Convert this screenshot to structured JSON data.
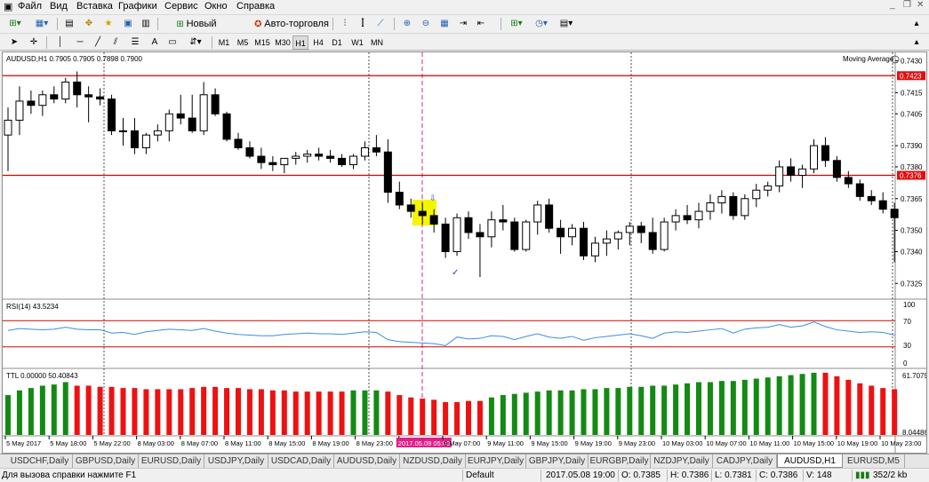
{
  "menu": {
    "items": [
      "Файл",
      "Вид",
      "Вставка",
      "Графики",
      "Сервис",
      "Окно",
      "Справка"
    ]
  },
  "toolbar": {
    "new_order_label": "Новый ордер",
    "autotrading_label": "Авто-торговля",
    "timeframes": [
      "M1",
      "M5",
      "M15",
      "M30",
      "H1",
      "H4",
      "D1",
      "W1",
      "MN"
    ],
    "active_timeframe": "H1",
    "text_tool_label": "A"
  },
  "chart_header": {
    "symbol_line": "AUDUSD,H1  0.7905 0.7905 0.7898 0.7900",
    "indicator_label": "Moving Average"
  },
  "rsi": {
    "label": "RSI(14) 43.5234",
    "levels": [
      "70",
      "30"
    ],
    "bottom_label": "0",
    "top_label": "100"
  },
  "ttl": {
    "label": "TTL 0.00000 50.40843",
    "top_value": "61.70795",
    "bottom_value": "8.04486"
  },
  "price_axis": {
    "ticks": [
      "0.7430",
      "0.7415",
      "0.7405",
      "0.7390",
      "0.7380",
      "0.7365",
      "0.7350",
      "0.7340",
      "0.7325"
    ],
    "highlight_high": "0.7423",
    "highlight_mid": "0.7376"
  },
  "time_axis": {
    "labels": [
      "5 May 2017",
      "5 May 18:00",
      "5 May 22:00",
      "8 May 03:00",
      "8 May 07:00",
      "8 May 11:00",
      "8 May 15:00",
      "8 May 19:00",
      "8 May 23:00",
      "2017.05.09 05:00",
      "9 May 07:00",
      "9 May 11:00",
      "9 May 15:00",
      "9 May 19:00",
      "9 May 23:00",
      "10 May 03:00",
      "10 May 07:00",
      "10 May 11:00",
      "10 May 15:00",
      "10 May 19:00",
      "10 May 23:00"
    ],
    "highlight_label": "2017.05.09 05:00"
  },
  "tabs": [
    "USDCHF,Daily",
    "GBPUSD,Daily",
    "EURUSD,Daily",
    "USDJPY,Daily",
    "USDCAD,Daily",
    "AUDUSD,Daily",
    "NZDUSD,Daily",
    "EURJPY,Daily",
    "GBPJPY,Daily",
    "EURGBP,Daily",
    "NZDJPY,Daily",
    "CADJPY,Daily",
    "AUDUSD,H1",
    "EURUSD,M5"
  ],
  "active_tab": "AUDUSD,H1",
  "status": {
    "help": "Для вызова справки нажмите F1",
    "profile": "Default",
    "datetime": "2017.05.08 19:00",
    "open": "O: 0.7385",
    "high": "H: 0.7386",
    "low": "L: 0.7381",
    "close": "C: 0.7386",
    "volume": "V: 148",
    "traffic": "352/2 kb"
  },
  "colors": {
    "candle_bull": "#ffffff",
    "candle_bear": "#000000",
    "level_line": "#d40000",
    "rsi_line": "#3a8ee6",
    "hist_green": "#138a13",
    "hist_red": "#ee1111",
    "crosshair": "#e0208a",
    "highlight": "#f5f500"
  },
  "chart_data": {
    "type": "candlestick",
    "symbol": "AUDUSD",
    "timeframe": "H1",
    "ylim": [
      0.7318,
      0.7434
    ],
    "horizontal_levels": [
      0.7423,
      0.7376
    ],
    "candles": [
      [
        0.7395,
        0.7408,
        0.7378,
        0.7402
      ],
      [
        0.7402,
        0.7418,
        0.7395,
        0.7411
      ],
      [
        0.7411,
        0.7416,
        0.7405,
        0.7409
      ],
      [
        0.7409,
        0.7416,
        0.7404,
        0.7414
      ],
      [
        0.7414,
        0.7418,
        0.741,
        0.7412
      ],
      [
        0.7412,
        0.7422,
        0.741,
        0.742
      ],
      [
        0.742,
        0.7425,
        0.7408,
        0.7414
      ],
      [
        0.7414,
        0.7418,
        0.7401,
        0.7413
      ],
      [
        0.7413,
        0.7417,
        0.7409,
        0.7412
      ],
      [
        0.7412,
        0.7414,
        0.7395,
        0.7397
      ],
      [
        0.7397,
        0.7403,
        0.739,
        0.7397
      ],
      [
        0.7397,
        0.7403,
        0.7386,
        0.7389
      ],
      [
        0.7389,
        0.7396,
        0.7386,
        0.7395
      ],
      [
        0.7395,
        0.74,
        0.7392,
        0.7397
      ],
      [
        0.7397,
        0.7407,
        0.7392,
        0.7405
      ],
      [
        0.7405,
        0.7414,
        0.74,
        0.7403
      ],
      [
        0.7403,
        0.7414,
        0.7396,
        0.7397
      ],
      [
        0.7397,
        0.742,
        0.7395,
        0.7414
      ],
      [
        0.7414,
        0.7417,
        0.7404,
        0.7405
      ],
      [
        0.7405,
        0.7406,
        0.7392,
        0.7393
      ],
      [
        0.7393,
        0.7396,
        0.7388,
        0.7389
      ],
      [
        0.7389,
        0.7392,
        0.7384,
        0.7385
      ],
      [
        0.7385,
        0.7389,
        0.7379,
        0.7382
      ],
      [
        0.7382,
        0.7385,
        0.7378,
        0.7381
      ],
      [
        0.7381,
        0.7384,
        0.7377,
        0.7384
      ],
      [
        0.7384,
        0.7387,
        0.7381,
        0.7385
      ],
      [
        0.7385,
        0.7388,
        0.7382,
        0.7386
      ],
      [
        0.7386,
        0.7389,
        0.7383,
        0.7385
      ],
      [
        0.7385,
        0.7388,
        0.7382,
        0.7384
      ],
      [
        0.7384,
        0.7386,
        0.738,
        0.7381
      ],
      [
        0.7381,
        0.7386,
        0.7379,
        0.7385
      ],
      [
        0.7385,
        0.7392,
        0.7383,
        0.7389
      ],
      [
        0.7389,
        0.7395,
        0.7385,
        0.7387
      ],
      [
        0.7387,
        0.7393,
        0.7363,
        0.7368
      ],
      [
        0.7368,
        0.7373,
        0.736,
        0.7362
      ],
      [
        0.7362,
        0.7365,
        0.7356,
        0.7359
      ],
      [
        0.7359,
        0.7363,
        0.7353,
        0.7357
      ],
      [
        0.7357,
        0.736,
        0.7349,
        0.7353
      ],
      [
        0.7353,
        0.7356,
        0.7337,
        0.734
      ],
      [
        0.734,
        0.7358,
        0.7338,
        0.7356
      ],
      [
        0.7356,
        0.7359,
        0.7346,
        0.7349
      ],
      [
        0.7349,
        0.7353,
        0.7328,
        0.7347
      ],
      [
        0.7347,
        0.7359,
        0.7342,
        0.7355
      ],
      [
        0.7355,
        0.7362,
        0.735,
        0.7354
      ],
      [
        0.7354,
        0.7356,
        0.734,
        0.7341
      ],
      [
        0.7341,
        0.7355,
        0.734,
        0.7354
      ],
      [
        0.7354,
        0.7364,
        0.7348,
        0.7362
      ],
      [
        0.7362,
        0.7365,
        0.7349,
        0.7351
      ],
      [
        0.7351,
        0.7355,
        0.7339,
        0.7347
      ],
      [
        0.7347,
        0.7353,
        0.7343,
        0.7351
      ],
      [
        0.7351,
        0.7354,
        0.7336,
        0.7338
      ],
      [
        0.7338,
        0.7347,
        0.7335,
        0.7344
      ],
      [
        0.7344,
        0.735,
        0.7338,
        0.7346
      ],
      [
        0.7346,
        0.735,
        0.7341,
        0.7349
      ],
      [
        0.7349,
        0.7354,
        0.7343,
        0.7352
      ],
      [
        0.7352,
        0.7354,
        0.7344,
        0.7349
      ],
      [
        0.7349,
        0.7356,
        0.7339,
        0.7341
      ],
      [
        0.7341,
        0.7356,
        0.734,
        0.7354
      ],
      [
        0.7354,
        0.736,
        0.735,
        0.7357
      ],
      [
        0.7357,
        0.7362,
        0.7353,
        0.7355
      ],
      [
        0.7355,
        0.7363,
        0.7351,
        0.7359
      ],
      [
        0.7359,
        0.7367,
        0.7355,
        0.7363
      ],
      [
        0.7363,
        0.7369,
        0.7358,
        0.7366
      ],
      [
        0.7366,
        0.7368,
        0.7355,
        0.7357
      ],
      [
        0.7357,
        0.7367,
        0.7355,
        0.7365
      ],
      [
        0.7365,
        0.7372,
        0.7361,
        0.7369
      ],
      [
        0.7369,
        0.7373,
        0.7366,
        0.7371
      ],
      [
        0.7371,
        0.7383,
        0.7368,
        0.738
      ],
      [
        0.738,
        0.7384,
        0.7373,
        0.7376
      ],
      [
        0.7376,
        0.7381,
        0.737,
        0.7379
      ],
      [
        0.7379,
        0.7393,
        0.7377,
        0.739
      ],
      [
        0.739,
        0.7394,
        0.738,
        0.7383
      ],
      [
        0.7383,
        0.7385,
        0.7373,
        0.7375
      ],
      [
        0.7375,
        0.7378,
        0.737,
        0.7372
      ],
      [
        0.7372,
        0.7374,
        0.7364,
        0.7366
      ],
      [
        0.7366,
        0.7369,
        0.7362,
        0.7364
      ],
      [
        0.7364,
        0.7368,
        0.7358,
        0.736
      ],
      [
        0.736,
        0.7363,
        0.7335,
        0.7356
      ]
    ],
    "rsi_values": [
      55,
      58,
      57,
      56,
      57,
      60,
      57,
      56,
      56,
      51,
      52,
      49,
      53,
      55,
      57,
      56,
      55,
      58,
      54,
      51,
      49,
      48,
      47,
      47,
      49,
      50,
      51,
      50,
      50,
      49,
      51,
      53,
      52,
      41,
      38,
      37,
      36,
      35,
      32,
      45,
      42,
      43,
      47,
      46,
      41,
      46,
      50,
      45,
      43,
      46,
      40,
      44,
      46,
      48,
      50,
      47,
      43,
      51,
      53,
      52,
      54,
      56,
      58,
      51,
      57,
      59,
      60,
      64,
      60,
      62,
      68,
      61,
      56,
      54,
      52,
      53,
      52,
      48
    ],
    "ttl_values": [
      42,
      46,
      48,
      50,
      51,
      53,
      50,
      50,
      49,
      49,
      48,
      48,
      47,
      47,
      47,
      47,
      48,
      49,
      49,
      48,
      48,
      47,
      47,
      46,
      46,
      45,
      45,
      45,
      45,
      45,
      46,
      46,
      46,
      45,
      42,
      40,
      39,
      38,
      36,
      36,
      37,
      37,
      40,
      42,
      43,
      44,
      45,
      46,
      46,
      46,
      47,
      47,
      48,
      48,
      49,
      49,
      50,
      50,
      51,
      52,
      53,
      53,
      54,
      54,
      55,
      56,
      57,
      58,
      59,
      60,
      61,
      61,
      58,
      55,
      52,
      50,
      48,
      47
    ],
    "ttl_colors": [
      "g",
      "g",
      "g",
      "g",
      "g",
      "g",
      "r",
      "r",
      "r",
      "r",
      "r",
      "r",
      "r",
      "r",
      "r",
      "r",
      "r",
      "r",
      "r",
      "r",
      "r",
      "r",
      "r",
      "r",
      "r",
      "r",
      "r",
      "r",
      "r",
      "r",
      "g",
      "g",
      "g",
      "r",
      "r",
      "r",
      "r",
      "r",
      "r",
      "r",
      "r",
      "r",
      "g",
      "g",
      "g",
      "g",
      "g",
      "g",
      "g",
      "g",
      "g",
      "g",
      "g",
      "g",
      "g",
      "g",
      "g",
      "g",
      "g",
      "g",
      "g",
      "g",
      "g",
      "g",
      "g",
      "g",
      "g",
      "g",
      "g",
      "g",
      "g",
      "r",
      "r",
      "r",
      "r",
      "r",
      "r",
      "r"
    ]
  }
}
